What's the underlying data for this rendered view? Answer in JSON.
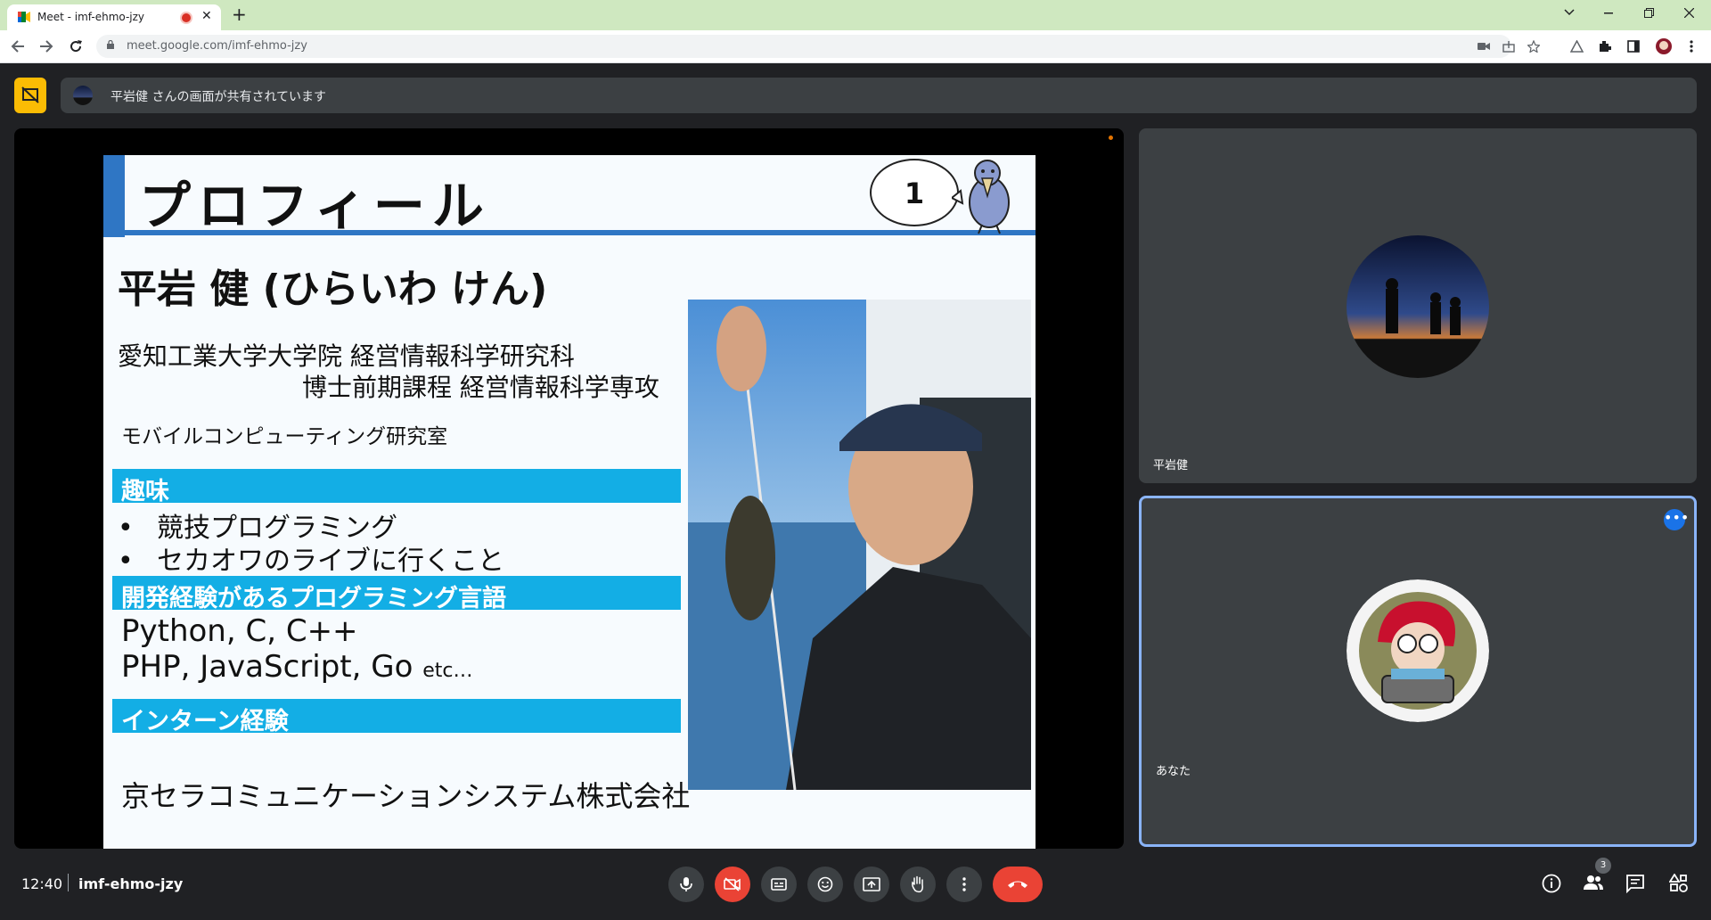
{
  "browser": {
    "tab_title": "Meet - imf-ehmo-jzy",
    "tab_close": "✕",
    "new_tab": "+",
    "url": "meet.google.com/imf-ehmo-jzy"
  },
  "banner": {
    "text": "平岩健 さんの画面が共有されています"
  },
  "slide": {
    "title": "プロフィール",
    "page_number": "1",
    "name": "平岩 健 (ひらいわ けん)",
    "university_line1": "愛知工業大学大学院 経営情報科学研究科",
    "university_line2": "博士前期課程 経営情報科学専攻",
    "lab": "モバイルコンピューティング研究室",
    "hobbies_heading": "趣味",
    "hobbies": [
      "競技プログラミング",
      "セカオワのライブに行くこと"
    ],
    "bullet": "•",
    "languages_heading": "開発経験があるプログラミング言語",
    "languages_line1": "Python, C, C++",
    "languages_line2": "PHP, JavaScript, Go",
    "languages_etc": "etc…",
    "intern_heading": "インターン経験",
    "company": "京セラコミュニケーションシステム株式会社"
  },
  "participants": [
    {
      "name": "平岩健"
    },
    {
      "name": "あなた"
    }
  ],
  "more_options": "•••",
  "footer": {
    "time": "12:40",
    "meeting_code": "imf-ehmo-jzy",
    "participant_count": "3"
  },
  "colors": {
    "accent_blue": "#1a73e8",
    "present_yellow": "#fbbc04",
    "hangup_red": "#ea4335",
    "section_cyan": "#13aee5"
  }
}
